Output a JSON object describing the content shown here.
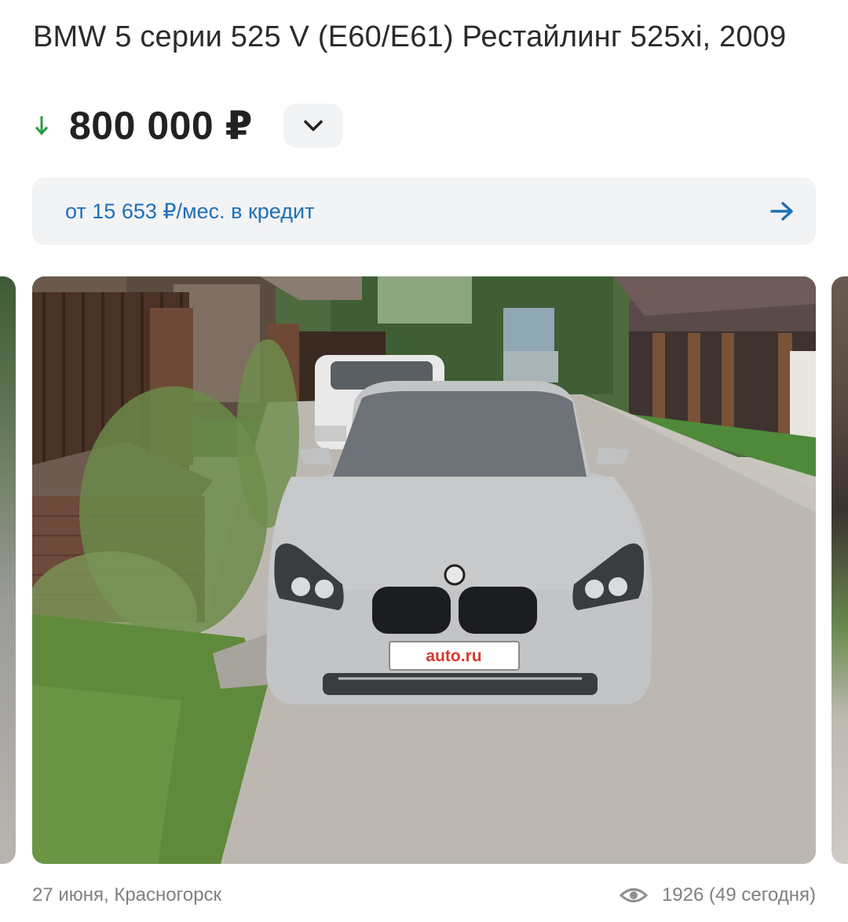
{
  "listing": {
    "title": "BMW 5 серии 525 V (E60/E61) Рестайлинг 525xi, 2009",
    "price": "800 000 ₽",
    "price_trend": "down",
    "credit_text": "от 15 653 ₽/мес. в кредит",
    "date_location": "27 июня, Красногорск",
    "views": "1926 (49 сегодня)",
    "plate_text": "auto.ru"
  },
  "colors": {
    "accent_blue": "#1f6fb8",
    "price_down_green": "#2e9b43",
    "card_bg": "#f2f3f5",
    "plate_red": "#d63a2f"
  },
  "icons": {
    "price_trend": "arrow-down-icon",
    "price_toggle": "chevron-down-icon",
    "credit": "arrow-right-icon",
    "views": "eye-icon"
  }
}
